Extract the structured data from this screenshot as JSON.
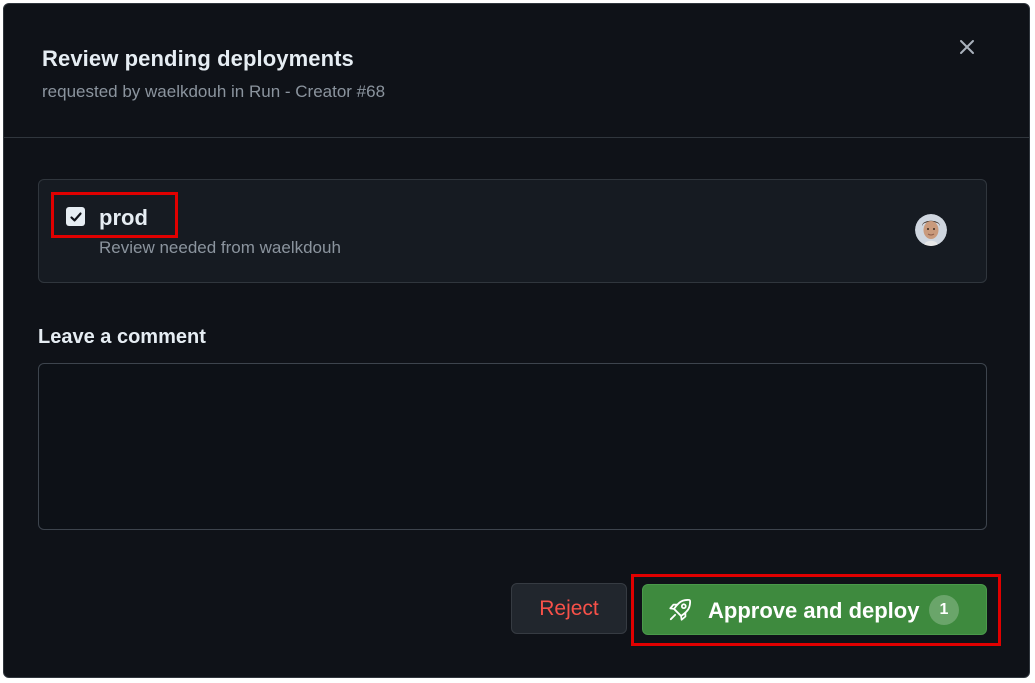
{
  "dialog": {
    "title": "Review pending deployments",
    "subtitle": "requested by waelkdouh in Run - Creator #68",
    "close_icon": "close-icon"
  },
  "environment": {
    "name": "prod",
    "checked": true,
    "review_text": "Review needed from waelkdouh",
    "avatar_icon": "user-avatar"
  },
  "comment": {
    "label": "Leave a comment",
    "value": "",
    "placeholder": ""
  },
  "actions": {
    "reject_label": "Reject",
    "approve_label": "Approve and deploy",
    "approve_icon": "rocket-icon",
    "approve_count": "1"
  },
  "colors": {
    "background": "#0f1218",
    "approve_green": "#3e8a3e",
    "reject_red": "#f85149",
    "highlight_red": "#e00000"
  }
}
